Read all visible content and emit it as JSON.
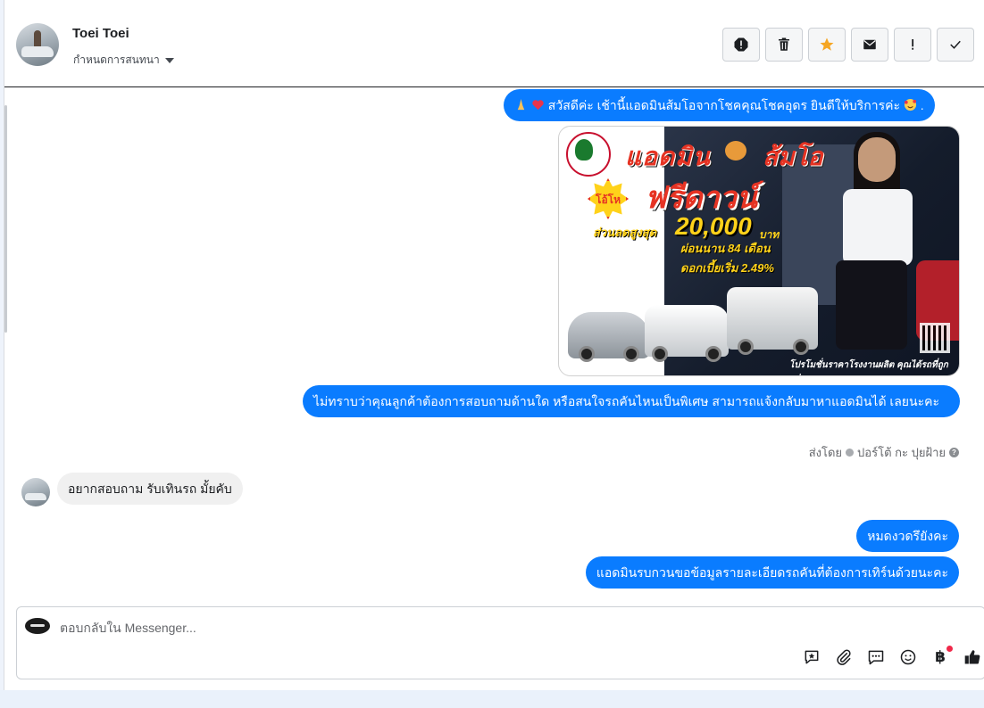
{
  "header": {
    "contact_name": "Toei Toei",
    "conversation_menu": "กำหนดการสนทนา",
    "actions": [
      {
        "name": "spam",
        "icon": "alert-octagon-icon"
      },
      {
        "name": "delete",
        "icon": "trash-icon"
      },
      {
        "name": "star",
        "icon": "star-icon",
        "color": "#f5a623"
      },
      {
        "name": "mark-unread",
        "icon": "envelope-icon"
      },
      {
        "name": "important",
        "icon": "exclamation-icon"
      },
      {
        "name": "done",
        "icon": "check-icon"
      }
    ]
  },
  "messages": {
    "greeting": "สวัสดีค่ะ เช้านี้แอดมินส้มโอจากโชคคุณโชคอุดร ยินดีให้บริการค่ะ",
    "greeting_suffix": ".",
    "question": "ไม่ทราบว่าคุณลูกค้าต้องการสอบถามด้านใด หรือสนใจรถคันไหนเป็นพิเศษ สามารถแจ้งกลับมาหาแอดมินได้ เลยนะคะ",
    "sent_by_prefix": "ส่งโดย",
    "sent_by_name": "ปอร์โต้ กะ ปุยฝ้าย",
    "customer_message": "อยากสอบถาม รับเทินรถ มั้ยคับ",
    "reply_1": "หมดงวดรึยังคะ",
    "reply_2": "แอดมินรบกวนขอข้อมูลรายละเอียดรถคันที่ต้องการเทิร์นด้วยนะคะ"
  },
  "promo_image": {
    "title_left": "แอดมิน",
    "title_right": "ส้มโอ",
    "badge": "โอ้โห",
    "headline": "ฟรีดาวน์",
    "discount_label": "ส่วนลดสูงสุด",
    "discount_amount": "20,000",
    "discount_unit": "บาท",
    "installment": "ผ่อนนาน 84 เดือน",
    "interest": "ดอกเบี้ยเริ่ม 2.49%",
    "footer": "โปรโมชั่นราคาโรงงานผลิต คุณได้รถที่ถูกกว่า"
  },
  "composer": {
    "placeholder": "ตอบกลับใน Messenger...",
    "tools": [
      "saved-reply-icon",
      "paperclip-icon",
      "chat-bubble-icon",
      "smiley-icon",
      "baht-icon",
      "thumbs-up-icon"
    ],
    "baht_symbol": "฿"
  }
}
